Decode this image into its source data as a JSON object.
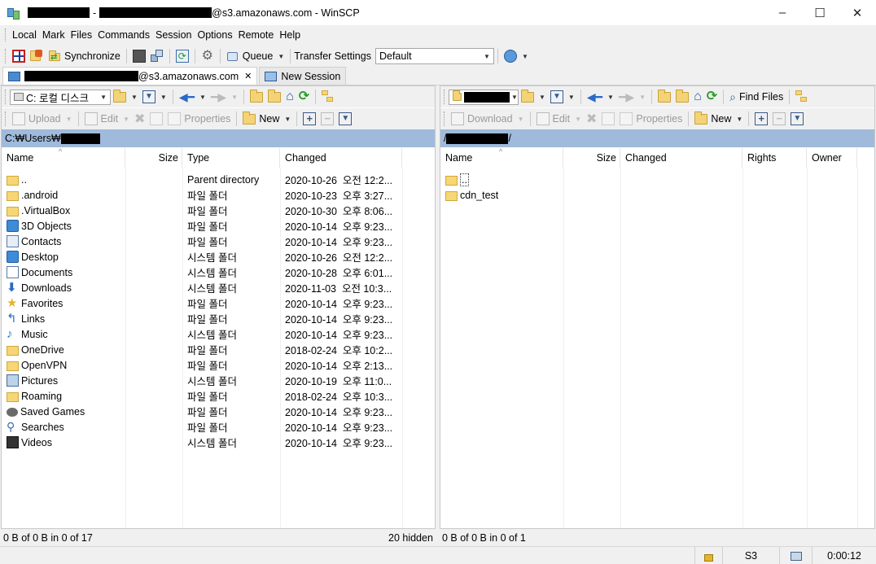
{
  "window": {
    "title_suffix": "@s3.amazonaws.com - WinSCP",
    "separator": "-",
    "minimize": "–",
    "maximize": "☐",
    "close": "✕"
  },
  "menu": [
    "Local",
    "Mark",
    "Files",
    "Commands",
    "Session",
    "Options",
    "Remote",
    "Help"
  ],
  "toolbar": {
    "synchronize": "Synchronize",
    "queue": "Queue",
    "transfer_settings_label": "Transfer Settings",
    "transfer_settings_value": "Default"
  },
  "tabs": {
    "session_suffix": "@s3.amazonaws.com",
    "session_close": "✕",
    "new_session": "New Session"
  },
  "local": {
    "drive": "C: 로컬 디스크",
    "upload": "Upload",
    "edit": "Edit",
    "properties": "Properties",
    "new": "New",
    "path_prefix": "C:₩Users₩",
    "columns": {
      "name": "Name",
      "size": "Size",
      "type": "Type",
      "changed": "Changed"
    },
    "rows": [
      {
        "icon": "up",
        "name": "..",
        "type": "Parent directory",
        "changed": "2020-10-26  오전 12:2..."
      },
      {
        "icon": "folder",
        "name": ".android",
        "type": "파일 폴더",
        "changed": "2020-10-23  오후 3:27..."
      },
      {
        "icon": "folder",
        "name": ".VirtualBox",
        "type": "파일 폴더",
        "changed": "2020-10-30  오후 8:06..."
      },
      {
        "icon": "blue",
        "name": "3D Objects",
        "type": "파일 폴더",
        "changed": "2020-10-14  오후 9:23..."
      },
      {
        "icon": "card",
        "name": "Contacts",
        "type": "파일 폴더",
        "changed": "2020-10-14  오후 9:23..."
      },
      {
        "icon": "blue",
        "name": "Desktop",
        "type": "시스템 폴더",
        "changed": "2020-10-26  오전 12:2..."
      },
      {
        "icon": "doc",
        "name": "Documents",
        "type": "시스템 폴더",
        "changed": "2020-10-28  오후 6:01..."
      },
      {
        "icon": "down",
        "name": "Downloads",
        "type": "시스템 폴더",
        "changed": "2020-11-03  오전 10:3..."
      },
      {
        "icon": "star",
        "name": "Favorites",
        "type": "파일 폴더",
        "changed": "2020-10-14  오후 9:23..."
      },
      {
        "icon": "link",
        "name": "Links",
        "type": "파일 폴더",
        "changed": "2020-10-14  오후 9:23..."
      },
      {
        "icon": "note",
        "name": "Music",
        "type": "시스템 폴더",
        "changed": "2020-10-14  오후 9:23..."
      },
      {
        "icon": "folder",
        "name": "OneDrive",
        "type": "파일 폴더",
        "changed": "2018-02-24  오후 10:2..."
      },
      {
        "icon": "folder",
        "name": "OpenVPN",
        "type": "파일 폴더",
        "changed": "2020-10-14  오후 2:13..."
      },
      {
        "icon": "pic",
        "name": "Pictures",
        "type": "시스템 폴더",
        "changed": "2020-10-19  오후 11:0..."
      },
      {
        "icon": "folder",
        "name": "Roaming",
        "type": "파일 폴더",
        "changed": "2018-02-24  오후 10:3..."
      },
      {
        "icon": "game",
        "name": "Saved Games",
        "type": "파일 폴더",
        "changed": "2020-10-14  오후 9:23..."
      },
      {
        "icon": "search",
        "name": "Searches",
        "type": "파일 폴더",
        "changed": "2020-10-14  오후 9:23..."
      },
      {
        "icon": "film",
        "name": "Videos",
        "type": "시스템 폴더",
        "changed": "2020-10-14  오후 9:23..."
      }
    ],
    "status_left": "0 B of 0 B in 0 of 17",
    "status_right": "20 hidden"
  },
  "remote": {
    "download": "Download",
    "edit": "Edit",
    "properties": "Properties",
    "new": "New",
    "find_files": "Find Files",
    "path_prefix": "/",
    "path_suffix": "/",
    "columns": {
      "name": "Name",
      "size": "Size",
      "changed": "Changed",
      "rights": "Rights",
      "owner": "Owner"
    },
    "rows": [
      {
        "icon": "up",
        "name": "..",
        "selected": true
      },
      {
        "icon": "folder",
        "name": "cdn_test"
      }
    ],
    "status_left": "0 B of 0 B in 0 of 1"
  },
  "statusbar": {
    "protocol": "S3",
    "timer": "0:00:12"
  }
}
